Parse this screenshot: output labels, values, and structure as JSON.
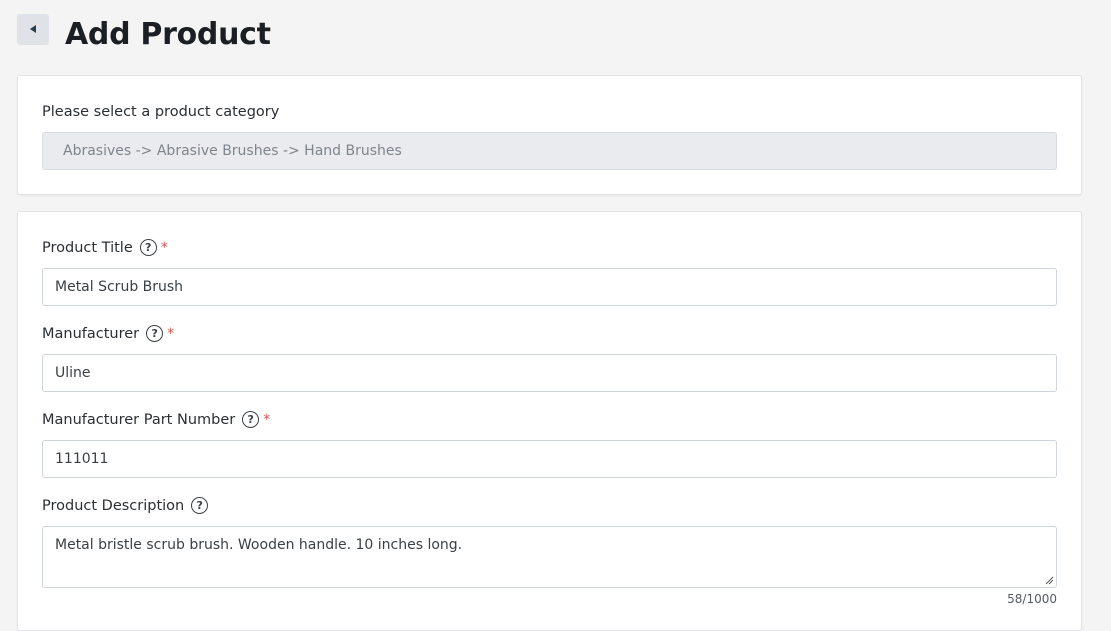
{
  "header": {
    "back_icon": "chevron-left-icon",
    "title": "Add Product"
  },
  "category": {
    "label": "Please select a product category",
    "value": "Abrasives -> Abrasive Brushes -> Hand Brushes"
  },
  "form": {
    "product_title": {
      "label": "Product Title",
      "required_mark": "*",
      "value": "Metal Scrub Brush"
    },
    "manufacturer": {
      "label": "Manufacturer",
      "required_mark": "*",
      "value": "Uline"
    },
    "part_number": {
      "label": "Manufacturer Part Number",
      "required_mark": "*",
      "value": "111011"
    },
    "description": {
      "label": "Product Description",
      "value": "Metal bristle scrub brush. Wooden handle. 10 inches long.",
      "char_count": "58/1000"
    },
    "help_glyph": "?"
  },
  "colors": {
    "required": "#d9534f",
    "background": "#f4f4f4",
    "disabled_input": "#e9ebee"
  }
}
